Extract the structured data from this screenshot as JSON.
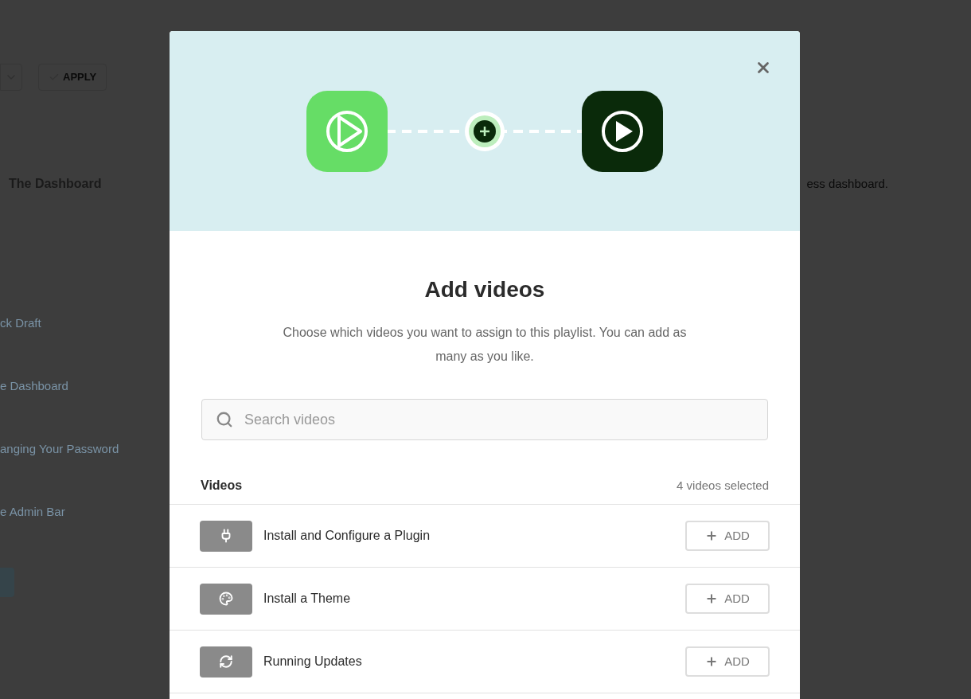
{
  "background": {
    "apply_button": "APPLY",
    "heading": "The Dashboard",
    "side_text": "ess dashboard.",
    "links": [
      "ck Draft",
      "e Dashboard",
      "anging Your Password",
      "e Admin Bar"
    ]
  },
  "modal": {
    "title": "Add videos",
    "description": "Choose which videos you want to assign to this playlist. You can add as many as you like.",
    "search": {
      "placeholder": "Search videos"
    },
    "list_header": {
      "label": "Videos",
      "count": "4 videos selected"
    },
    "videos": [
      {
        "title": "Install and Configure a Plugin",
        "kind": "plugin",
        "action": "ADD"
      },
      {
        "title": "Install a Theme",
        "kind": "theme",
        "action": "ADD"
      },
      {
        "title": "Running Updates",
        "kind": "updates",
        "action": "ADD"
      }
    ]
  }
}
